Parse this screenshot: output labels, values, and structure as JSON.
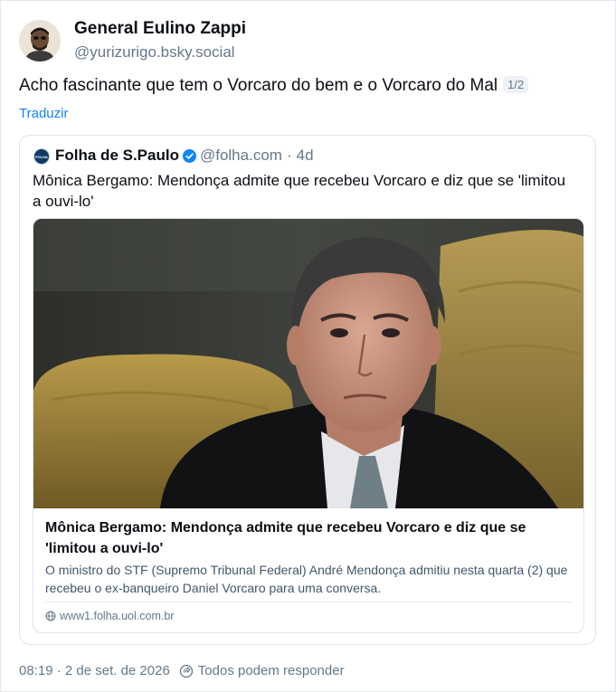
{
  "post": {
    "author_name": "General Eulino Zappi",
    "author_handle": "@yurizurigo.bsky.social",
    "text": "Acho fascinante que tem o Vorcaro do bem e o Vorcaro do Mal",
    "thread_badge": "1/2",
    "translate_label": "Traduzir",
    "timestamp": "08:19 · 2 de set. de 2026",
    "reply_setting": "Todos podem responder"
  },
  "quote": {
    "avatar_text": "FOLHA",
    "author_name": "Folha de S.Paulo",
    "author_handle": "@folha.com",
    "separator": "·",
    "age": "4d",
    "text": "Mônica Bergamo: Mendonça admite que recebeu Vorcaro e diz que se 'limitou a ouvi-lo'",
    "embed": {
      "title": "Mônica Bergamo: Mendonça admite que recebeu Vorcaro e diz que se 'limitou a ouvi-lo'",
      "description": "O ministro do STF (Supremo Tribunal Federal) André Mendonça admitiu nesta quarta (2) que recebeu o ex-banqueiro Daniel Vorcaro para uma conversa.",
      "domain": "www1.folha.uol.com.br"
    }
  },
  "colors": {
    "link": "#1083fe",
    "muted": "#66788a",
    "verified": "#1083fe"
  },
  "icons": [
    "verified-badge-icon",
    "globe-icon",
    "reply-settings-icon"
  ]
}
